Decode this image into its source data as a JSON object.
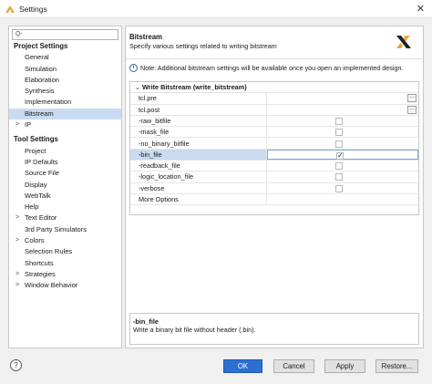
{
  "window": {
    "title": "Settings",
    "close_glyph": "✕"
  },
  "search": {
    "placeholder": "Q-"
  },
  "tree": {
    "project_settings_label": "Project Settings",
    "project_items": [
      "General",
      "Simulation",
      "Elaboration",
      "Synthesis",
      "Implementation",
      "Bitstream",
      "IP"
    ],
    "tool_settings_label": "Tool Settings",
    "tool_items": [
      "Project",
      "IP Defaults",
      "Source File",
      "Display",
      "WebTalk",
      "Help",
      "Text Editor",
      "3rd Party Simulators",
      "Colors",
      "Selection Rules",
      "Shortcuts",
      "Strategies",
      "Window Behavior"
    ],
    "selected": "Bitstream"
  },
  "header": {
    "title": "Bitstream",
    "description": "Specify various settings related to writing bitstream"
  },
  "note": "Note: Additional bitstream settings will be available once you open an implemented design.",
  "options": {
    "group_label": "Write Bitstream (write_bitstream)",
    "rows": [
      {
        "name": "tcl.pre",
        "kind": "file",
        "checked": false
      },
      {
        "name": "tcl.post",
        "kind": "file",
        "checked": false
      },
      {
        "name": "-raw_bitfile",
        "kind": "check",
        "checked": false
      },
      {
        "name": "-mask_file",
        "kind": "check",
        "checked": false
      },
      {
        "name": "-no_binary_bitfile",
        "kind": "check",
        "checked": false
      },
      {
        "name": "-bin_file",
        "kind": "check",
        "checked": true
      },
      {
        "name": "-readback_file",
        "kind": "check",
        "checked": false
      },
      {
        "name": "-logic_location_file",
        "kind": "check",
        "checked": false
      },
      {
        "name": "-verbose",
        "kind": "check",
        "checked": false
      },
      {
        "name": "More Options",
        "kind": "text",
        "checked": false
      }
    ],
    "selected_row": "-bin_file"
  },
  "description_box": {
    "title": "-bin_file",
    "text": "Write a binary bit file without header (.bin)."
  },
  "footer": {
    "help_glyph": "?",
    "ok": "OK",
    "cancel": "Cancel",
    "apply": "Apply",
    "restore": "Restore..."
  },
  "colors": {
    "accent": "#2d6fd0",
    "selection": "#c9dbf0"
  }
}
